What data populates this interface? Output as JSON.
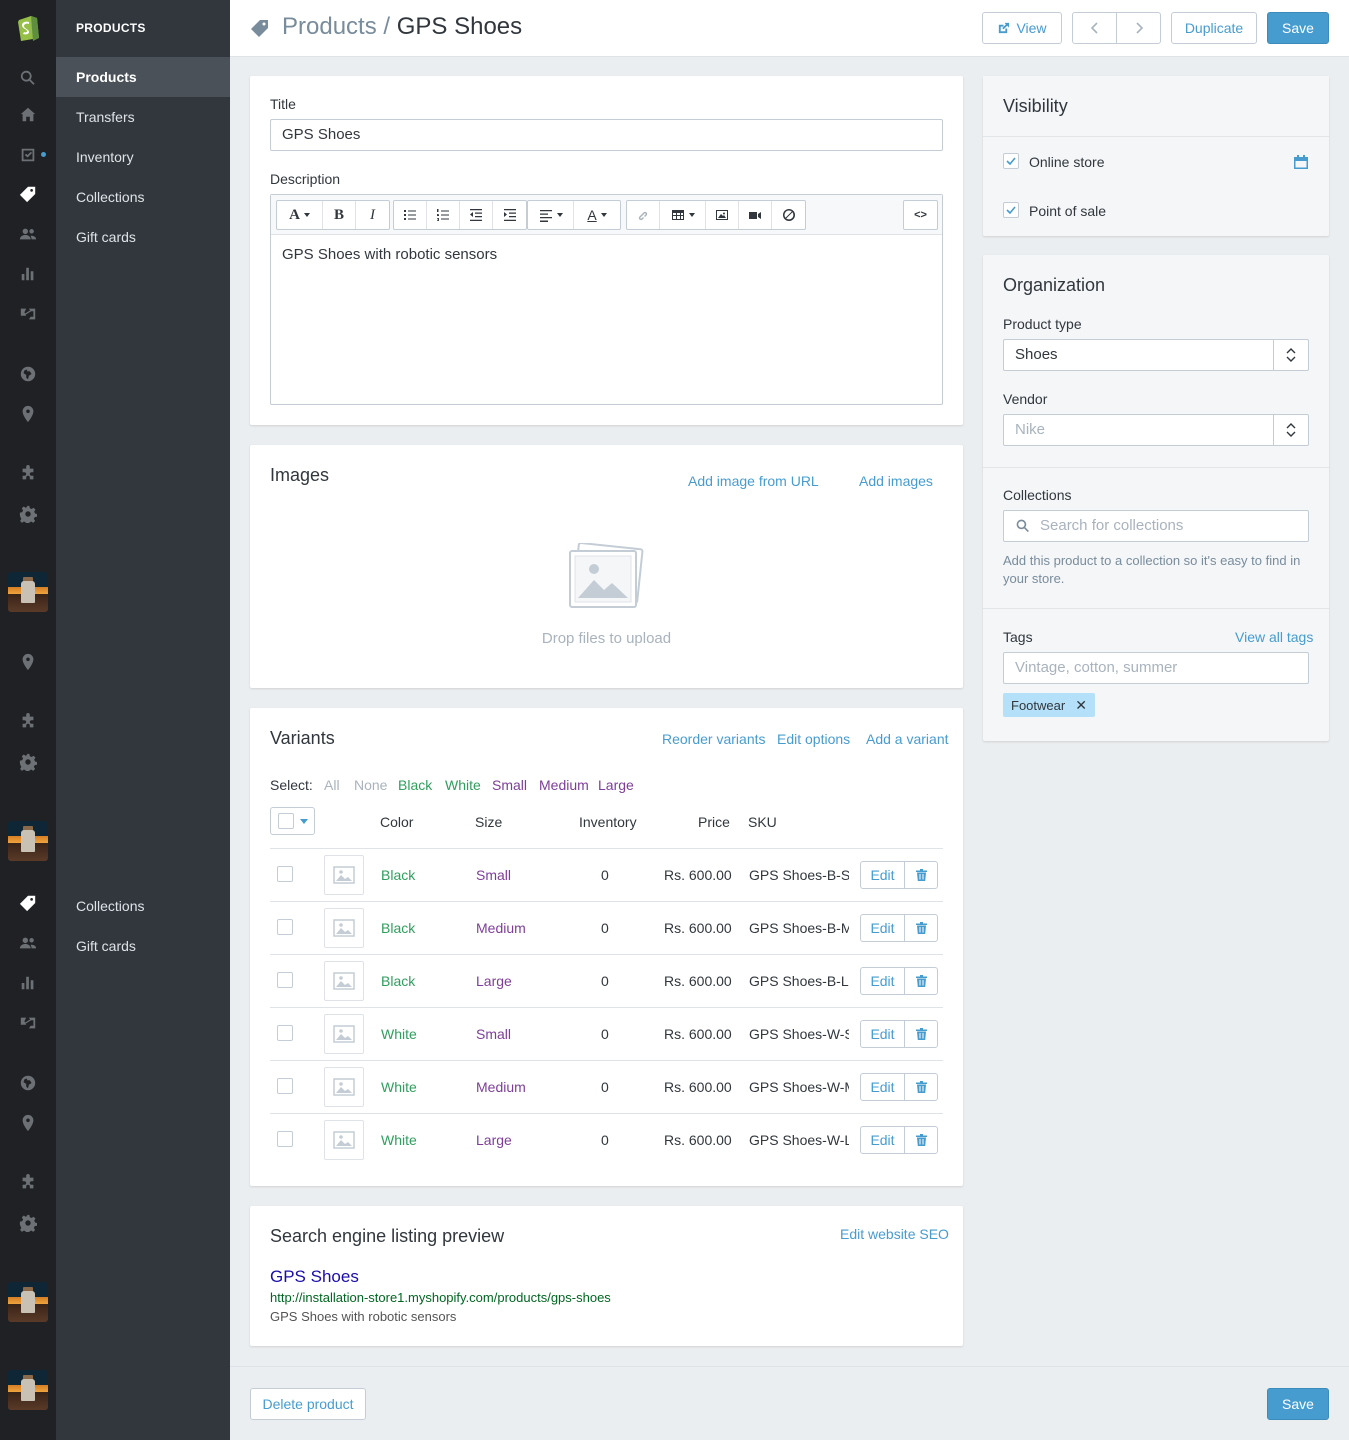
{
  "sidebar": {
    "section_title": "PRODUCTS",
    "items": [
      {
        "label": "Products"
      },
      {
        "label": "Transfers"
      },
      {
        "label": "Inventory"
      },
      {
        "label": "Collections"
      },
      {
        "label": "Gift cards"
      }
    ],
    "items2": [
      {
        "label": "Collections"
      },
      {
        "label": "Gift cards"
      }
    ]
  },
  "header": {
    "crumb": "Products",
    "sep": " / ",
    "title": "GPS Shoes",
    "view_label": "View",
    "duplicate_label": "Duplicate",
    "save_label": "Save"
  },
  "product": {
    "title_label": "Title",
    "title_value": "GPS Shoes",
    "description_label": "Description",
    "description_text": "GPS Shoes with robotic sensors",
    "code_label": "<>"
  },
  "images": {
    "heading": "Images",
    "add_url_label": "Add image from URL",
    "add_images_label": "Add images",
    "drop_text": "Drop files to upload"
  },
  "variants": {
    "heading": "Variants",
    "reorder_label": "Reorder variants",
    "edit_options_label": "Edit options",
    "add_variant_label": "Add a variant",
    "select_label": "Select:",
    "filters": {
      "all": "All",
      "none": "None",
      "black": "Black",
      "white": "White",
      "small": "Small",
      "medium": "Medium",
      "large": "Large"
    },
    "columns": {
      "color": "Color",
      "size": "Size",
      "inventory": "Inventory",
      "price": "Price",
      "sku": "SKU"
    },
    "edit_label": "Edit",
    "rows": [
      {
        "color": "Black",
        "size": "Small",
        "inventory": "0",
        "price": "Rs. 600.00",
        "sku": "GPS Shoes-B-S"
      },
      {
        "color": "Black",
        "size": "Medium",
        "inventory": "0",
        "price": "Rs. 600.00",
        "sku": "GPS Shoes-B-M"
      },
      {
        "color": "Black",
        "size": "Large",
        "inventory": "0",
        "price": "Rs. 600.00",
        "sku": "GPS Shoes-B-L"
      },
      {
        "color": "White",
        "size": "Small",
        "inventory": "0",
        "price": "Rs. 600.00",
        "sku": "GPS Shoes-W-S"
      },
      {
        "color": "White",
        "size": "Medium",
        "inventory": "0",
        "price": "Rs. 600.00",
        "sku": "GPS Shoes-W-M"
      },
      {
        "color": "White",
        "size": "Large",
        "inventory": "0",
        "price": "Rs. 600.00",
        "sku": "GPS Shoes-W-L"
      }
    ]
  },
  "seo": {
    "heading": "Search engine listing preview",
    "edit_label": "Edit website SEO",
    "title": "GPS Shoes",
    "url": "http://installation-store1.myshopify.com/products/gps-shoes",
    "description": "GPS Shoes with robotic sensors"
  },
  "visibility": {
    "heading": "Visibility",
    "online_store_label": "Online store",
    "pos_label": "Point of sale"
  },
  "organization": {
    "heading": "Organization",
    "product_type_label": "Product type",
    "product_type_value": "Shoes",
    "vendor_label": "Vendor",
    "vendor_placeholder": "Nike",
    "collections_label": "Collections",
    "collections_placeholder": "Search for collections",
    "collections_help": "Add this product to a collection so it's easy to find in your store.",
    "tags_label": "Tags",
    "view_all_tags_label": "View all tags",
    "tags_placeholder": "Vintage, cotton, summer",
    "tags": [
      "Footwear"
    ]
  },
  "footer": {
    "delete_label": "Delete product",
    "save_label": "Save"
  },
  "colors": {
    "accent": "#479ccf",
    "green": "#2e9f5c",
    "purple": "#7e3e98",
    "sidebar": "#31373d",
    "rail": "#1f2124"
  }
}
